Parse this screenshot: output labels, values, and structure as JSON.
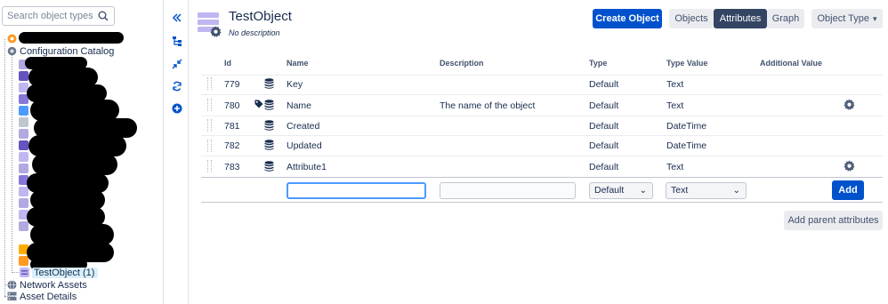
{
  "search": {
    "placeholder": "Search object types"
  },
  "tree": {
    "configuration_catalog": "Configuration Catalog",
    "selected_item": "TestObject (1)",
    "network_assets": "Network Assets",
    "asset_details": "Asset Details"
  },
  "object": {
    "title": "TestObject",
    "description": "No description"
  },
  "toolbar": {
    "create": "Create Object",
    "objects": "Objects",
    "attributes": "Attributes",
    "graph": "Graph",
    "object_type": "Object Type"
  },
  "table": {
    "headers": {
      "id": "Id",
      "name": "Name",
      "description": "Description",
      "type": "Type",
      "type_value": "Type Value",
      "additional_value": "Additional Value"
    },
    "rows": [
      {
        "id": "779",
        "name": "Key",
        "description": "",
        "type": "Default",
        "type_value": "Text",
        "label_icon": false,
        "gear": false
      },
      {
        "id": "780",
        "name": "Name",
        "description": "The name of the object",
        "type": "Default",
        "type_value": "Text",
        "label_icon": true,
        "gear": true
      },
      {
        "id": "781",
        "name": "Created",
        "description": "",
        "type": "Default",
        "type_value": "DateTime",
        "label_icon": false,
        "gear": false
      },
      {
        "id": "782",
        "name": "Updated",
        "description": "",
        "type": "Default",
        "type_value": "DateTime",
        "label_icon": false,
        "gear": false
      },
      {
        "id": "783",
        "name": "Attribute1",
        "description": "",
        "type": "Default",
        "type_value": "Text",
        "label_icon": false,
        "gear": true
      }
    ]
  },
  "add_form": {
    "name_value": "",
    "description_value": "",
    "type_selected": "Default",
    "type_value_selected": "Text",
    "add": "Add"
  },
  "add_parent": "Add parent attributes",
  "colors": {
    "primary": "#0052cc",
    "selected_tab": "#344563",
    "selection_bg": "#d9f0fb"
  }
}
